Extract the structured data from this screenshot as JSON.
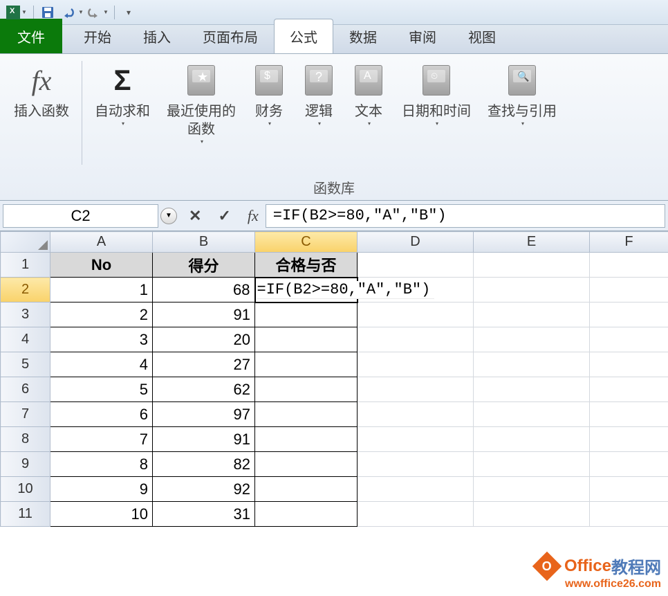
{
  "qat": {
    "save_title": "保存",
    "undo_title": "撤销",
    "redo_title": "重做"
  },
  "tabs": {
    "file": "文件",
    "home": "开始",
    "insert": "插入",
    "page_layout": "页面布局",
    "formulas": "公式",
    "data": "数据",
    "review": "审阅",
    "view": "视图"
  },
  "ribbon": {
    "insert_fn": "插入函数",
    "autosum": "自动求和",
    "recent": "最近使用的\n函数",
    "financial": "财务",
    "logical": "逻辑",
    "text": "文本",
    "datetime": "日期和时间",
    "lookup": "查找与引用",
    "group_label": "函数库"
  },
  "formula_bar": {
    "name_box": "C2",
    "cancel": "✕",
    "enter": "✓",
    "fx": "fx",
    "formula": "=IF(B2>=80,\"A\",\"B\")"
  },
  "grid": {
    "columns": [
      "A",
      "B",
      "C",
      "D",
      "E",
      "F"
    ],
    "active_col": "C",
    "active_row": 2,
    "headers": {
      "A": "No",
      "B": "得分",
      "C": "合格与否"
    },
    "editing_cell_text": "=IF(B2>=80,\"A\",\"B\")",
    "rows": [
      {
        "r": 2,
        "A": "1",
        "B": "68"
      },
      {
        "r": 3,
        "A": "2",
        "B": "91"
      },
      {
        "r": 4,
        "A": "3",
        "B": "20"
      },
      {
        "r": 5,
        "A": "4",
        "B": "27"
      },
      {
        "r": 6,
        "A": "5",
        "B": "62"
      },
      {
        "r": 7,
        "A": "6",
        "B": "97"
      },
      {
        "r": 8,
        "A": "7",
        "B": "91"
      },
      {
        "r": 9,
        "A": "8",
        "B": "82"
      },
      {
        "r": 10,
        "A": "9",
        "B": "92"
      },
      {
        "r": 11,
        "A": "10",
        "B": "31"
      }
    ]
  },
  "watermark": {
    "brand_office": "Office",
    "brand_cn": "教程网",
    "url": "www.office26.com"
  }
}
